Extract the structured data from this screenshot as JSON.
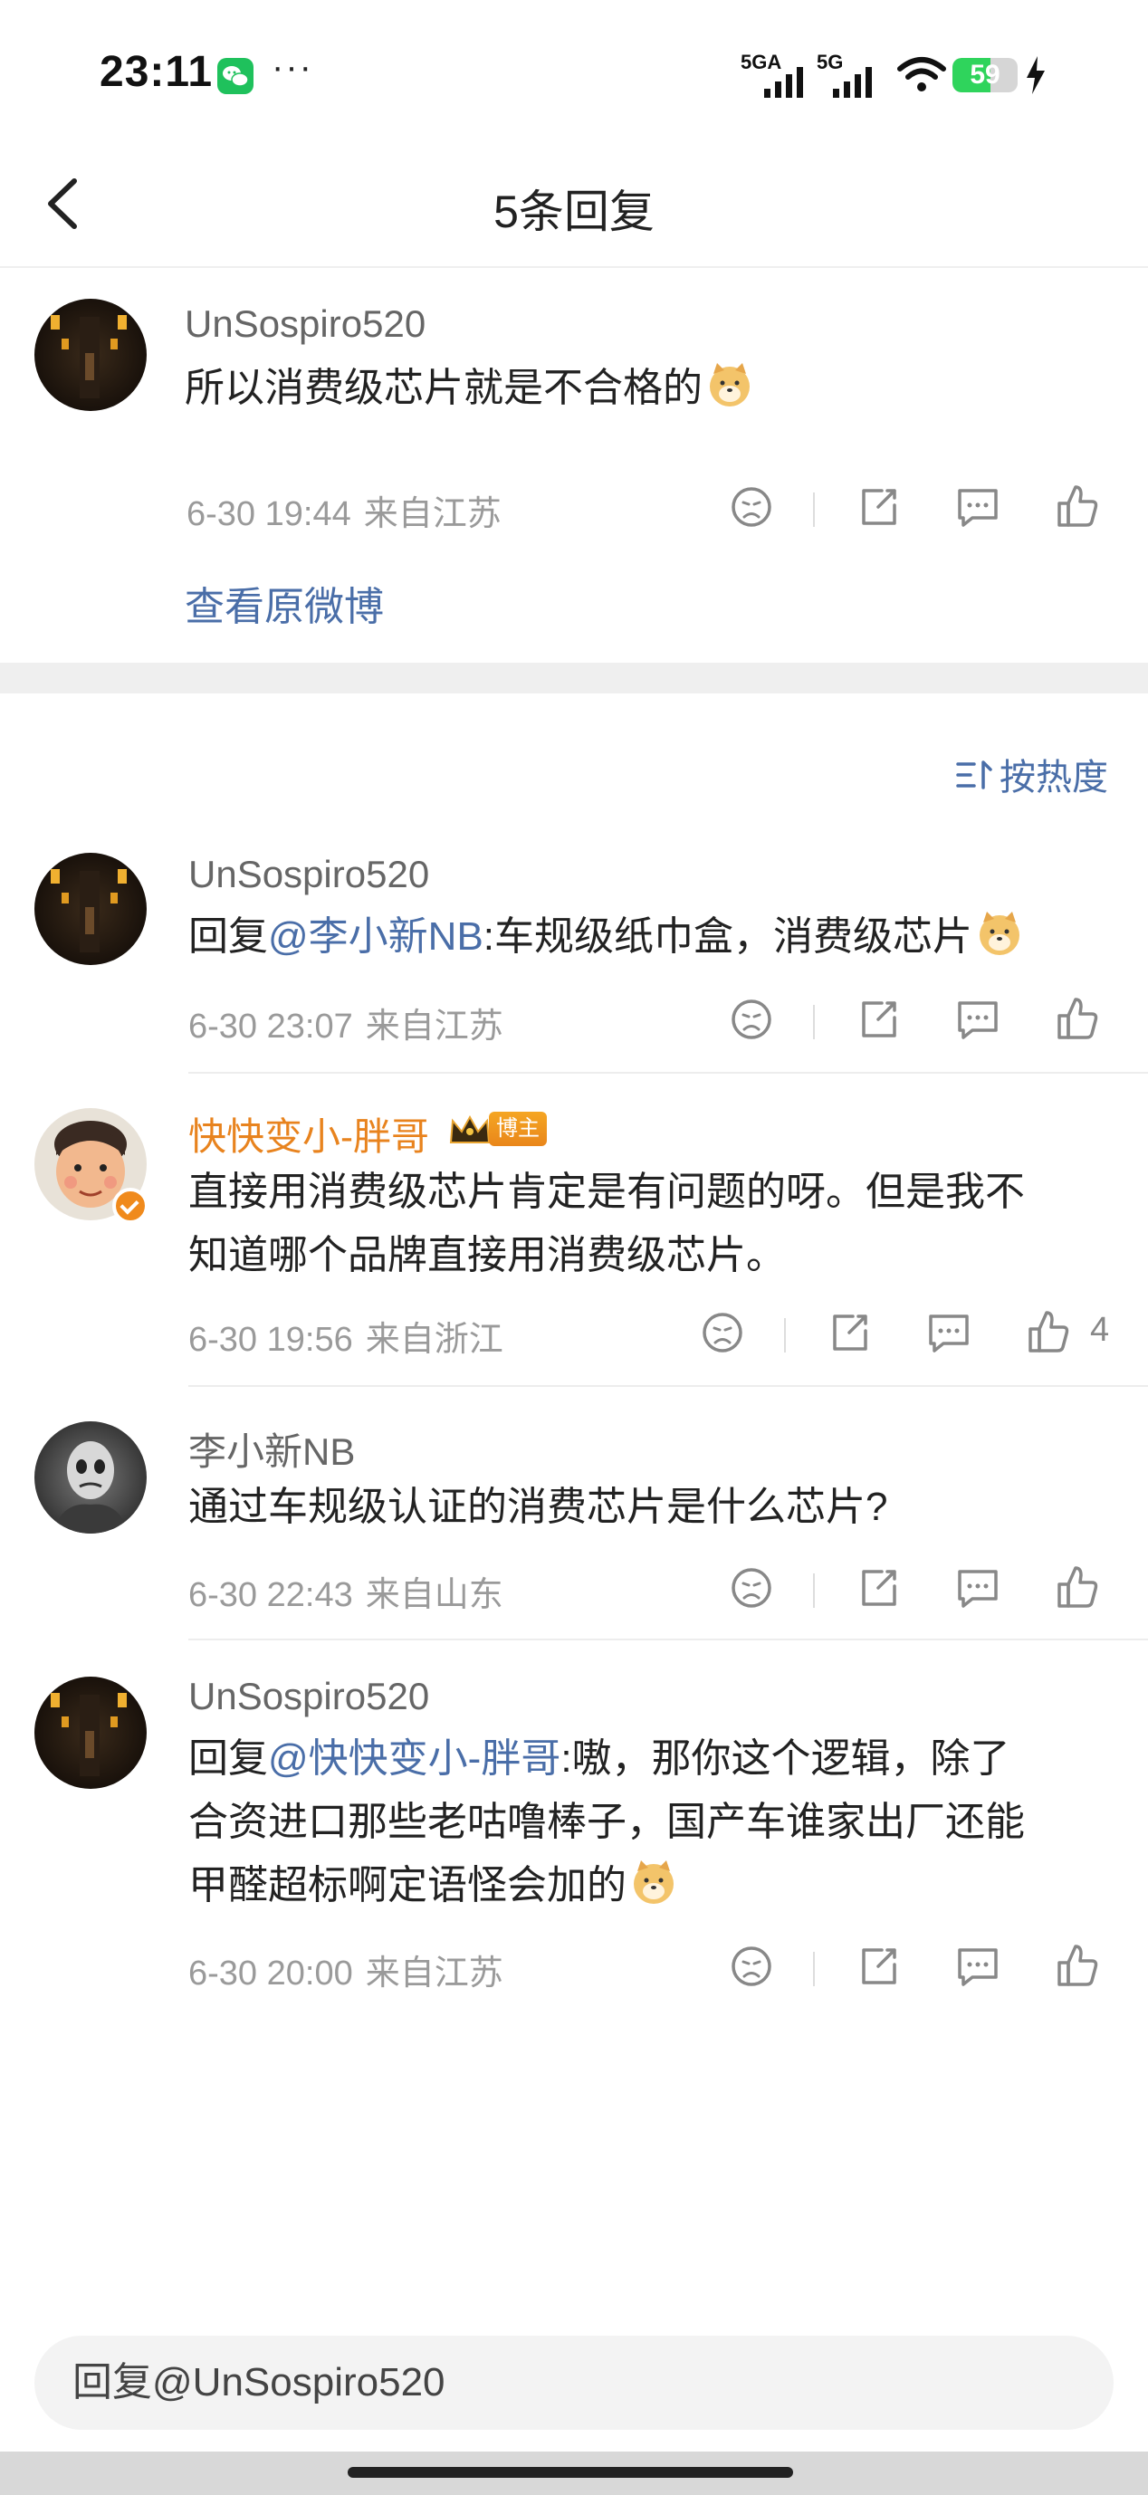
{
  "status_bar": {
    "time": "23:11",
    "dots": "···",
    "net1": "5GA",
    "net2": "5G",
    "battery": "59",
    "battery_level": 0.59
  },
  "header": {
    "title": "5条回复"
  },
  "root_comment": {
    "username": "UnSospiro520",
    "text": "所以消费级芯片就是不合格的",
    "time": "6-30 19:44",
    "location": "来自江苏",
    "view_original": "查看原微博"
  },
  "sort": {
    "label": "按热度"
  },
  "replies": [
    {
      "username": "UnSospiro520",
      "prefix": "回复",
      "mention": "@李小新NB",
      "text": ":车规级纸巾盒，消费级芯片",
      "time": "6-30 23:07",
      "location": "来自江苏"
    },
    {
      "username": "快快变小-胖哥",
      "badge": "博主",
      "text_line1": "直接用消费级芯片肯定是有问题的呀。但是我不",
      "text_line2": "知道哪个品牌直接用消费级芯片。",
      "time": "6-30 19:56",
      "location": "来自浙江",
      "likes": "4"
    },
    {
      "username": "李小新NB",
      "text": "通过车规级认证的消费芯片是什么芯片?",
      "time": "6-30 22:43",
      "location": "来自山东"
    },
    {
      "username": "UnSospiro520",
      "prefix": "回复",
      "mention": "@快快变小-胖哥",
      "text_line1": ":嗷，那你这个逻辑，除了",
      "text_line2": "合资进口那些老咕噜棒子，国产车谁家出厂还能",
      "text_line3": "甲醛超标啊定语怪会加的",
      "time": "6-30 20:00",
      "location": "来自江苏"
    }
  ],
  "reply_box": {
    "placeholder": "回复@UnSospiro520"
  },
  "colors": {
    "link": "#4a6ea8",
    "blogger_name": "#e8831e",
    "meta": "#9a9a9a"
  },
  "icons": [
    "wechat-icon",
    "signal-icon",
    "wifi-icon",
    "battery-icon",
    "charging-icon",
    "back-icon",
    "dislike-icon",
    "repost-icon",
    "comment-icon",
    "like-icon",
    "sort-icon",
    "doge-emoji",
    "crown-icon",
    "verified-icon"
  ]
}
